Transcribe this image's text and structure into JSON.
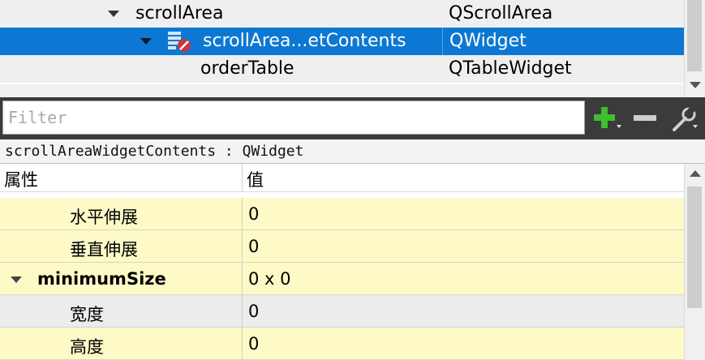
{
  "object_tree": {
    "rows": [
      {
        "name": "scrollArea",
        "class": "QScrollArea",
        "expanded": true
      },
      {
        "name": "scrollArea...etContents",
        "class": "QWidget",
        "expanded": true,
        "selected": true
      },
      {
        "name": "orderTable",
        "class": "QTableWidget"
      }
    ]
  },
  "toolbar": {
    "filter_placeholder": "Filter",
    "add_icon": "plus-icon",
    "remove_icon": "minus-icon",
    "configure_icon": "wrench-icon"
  },
  "class_label": "scrollAreaWidgetContents : QWidget",
  "property_table": {
    "header_property": "属性",
    "header_value": "值",
    "rows": [
      {
        "name": "水平伸展",
        "value": "0"
      },
      {
        "name": "垂直伸展",
        "value": "0"
      },
      {
        "name": "minimumSize",
        "value": "0 x 0"
      },
      {
        "name": "宽度",
        "value": "0"
      },
      {
        "name": "高度",
        "value": "0"
      }
    ]
  },
  "colors": {
    "selection": "#0c78d3",
    "property_highlight": "#fdfac8",
    "toolbar_bg": "#3b3b3b",
    "add_green": "#3fbf2f"
  }
}
